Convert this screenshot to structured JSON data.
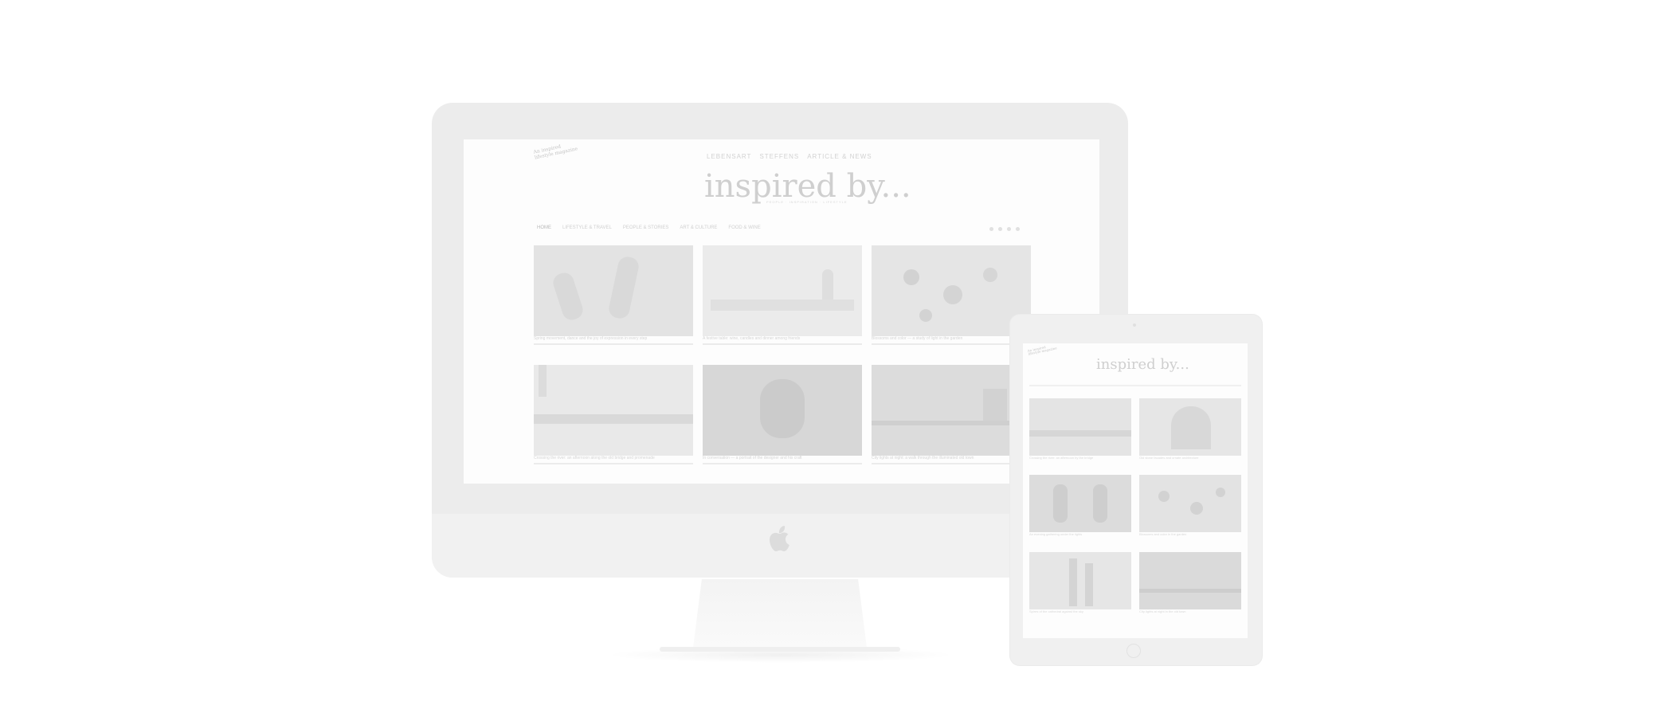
{
  "site": {
    "stamp_lines": [
      "An inspired",
      "lifestyle magazine"
    ],
    "top_links": [
      "LEBENSART",
      "STEFFENS",
      "ARTICLE & NEWS"
    ],
    "logo": "inspired by...",
    "tagline": "PEOPLE · INSPIRATION · LIFESTYLE",
    "nav": [
      "HOME",
      "LIFESTYLE & TRAVEL",
      "PEOPLE & STORIES",
      "ART & CULTURE",
      "FOOD & WINE"
    ]
  },
  "desktop_cards": [
    {
      "image": "dancers-photo",
      "caption": "Spring movement, dance and the joy of expression in every step"
    },
    {
      "image": "table-setting-photo",
      "caption": "A festive table: wine, candles and dinner among friends"
    },
    {
      "image": "flowers-photo",
      "caption": "Blossoms and color — a study of light in the garden"
    },
    {
      "image": "bridge-photo",
      "caption": "Crossing the river: an afternoon along the old bridge and promenade"
    },
    {
      "image": "portrait-photo",
      "caption": "In conversation — a portrait of the designer and his craft"
    },
    {
      "image": "night-street-photo",
      "caption": "City lights at night: a walk through the illuminated old town"
    }
  ],
  "tablet_cards": [
    {
      "image": "bridge-photo",
      "caption": "Crossing the river: an afternoon by the bridge"
    },
    {
      "image": "architecture-photo",
      "caption": "Old stone facades and ornate architecture"
    },
    {
      "image": "night-event-photo",
      "caption": "An evening gathering under the lights"
    },
    {
      "image": "flowers-photo",
      "caption": "Blossoms and color in the garden"
    },
    {
      "image": "cathedral-photo",
      "caption": "Spires of the cathedral against the sky"
    },
    {
      "image": "night-street-photo",
      "caption": "City lights at night in the old town"
    }
  ],
  "colors": {
    "frame": "#ececec",
    "screen": "#fdfdfd",
    "image": "#e6e6e6"
  }
}
